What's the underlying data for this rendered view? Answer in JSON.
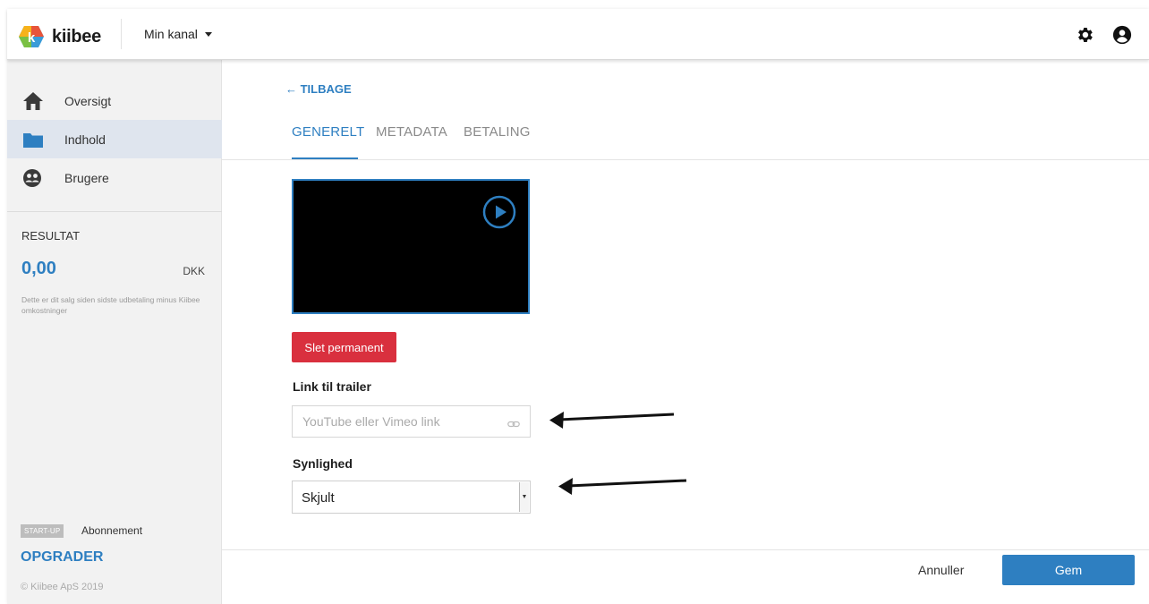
{
  "header": {
    "logo_text": "kiibee",
    "logo_letter": "k",
    "channel_label": "Min kanal"
  },
  "sidebar": {
    "items": [
      {
        "label": "Oversigt",
        "icon": "home-icon"
      },
      {
        "label": "Indhold",
        "icon": "folder-icon"
      },
      {
        "label": "Brugere",
        "icon": "users-icon"
      }
    ],
    "result": {
      "title": "RESULTAT",
      "value": "0,00",
      "currency": "DKK",
      "description": "Dette er dit salg siden sidste udbetaling minus Kiibee omkostninger"
    },
    "plan": {
      "badge": "START-UP",
      "label": "Abonnement",
      "upgrade": "OPGRADER"
    },
    "copyright": "© Kiibee ApS 2019"
  },
  "main": {
    "back_label": "← TILBAGE",
    "tabs": [
      {
        "label": "GENERELT",
        "active": true
      },
      {
        "label": "METADATA",
        "active": false
      },
      {
        "label": "BETALING",
        "active": false
      }
    ],
    "delete_label": "Slet permanent",
    "trailer": {
      "label": "Link til trailer",
      "placeholder": "YouTube eller Vimeo link",
      "value": ""
    },
    "visibility": {
      "label": "Synlighed",
      "value": "Skjult"
    }
  },
  "footer": {
    "cancel_label": "Annuller",
    "save_label": "Gem"
  },
  "colors": {
    "accent": "#2e7fc1",
    "danger": "#d9303e",
    "sidebar_bg": "#f2f2f2",
    "active_nav": "#dfe5ee"
  }
}
